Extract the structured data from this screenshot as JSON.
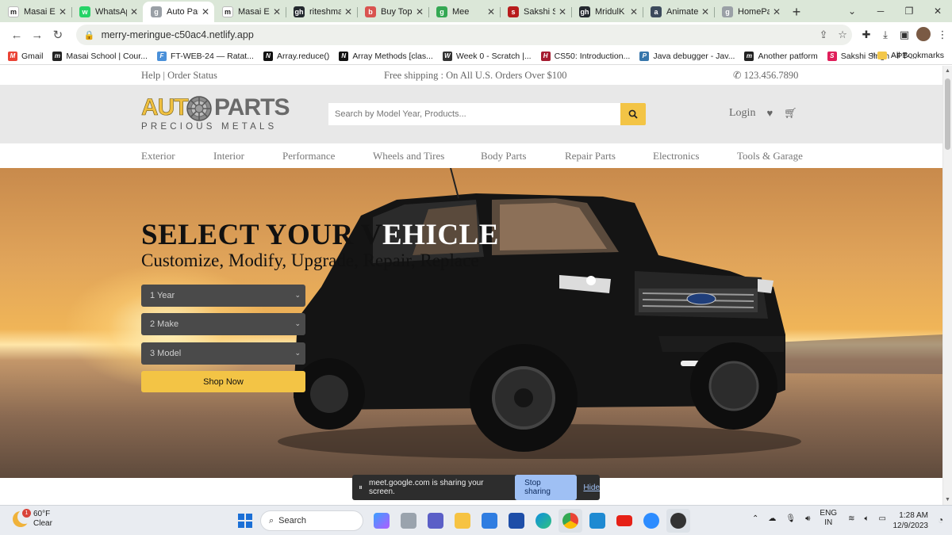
{
  "browser": {
    "tabs": [
      {
        "title": "Masai Ex",
        "fav": "m",
        "color": "#ffffff",
        "fg": "#222",
        "active": false
      },
      {
        "title": "WhatsAp",
        "fav": "w",
        "color": "#25d366",
        "fg": "#fff",
        "active": false
      },
      {
        "title": "Auto Par",
        "fav": "g",
        "color": "#9aa0a6",
        "fg": "#fff",
        "active": true
      },
      {
        "title": "Masai Ex",
        "fav": "m",
        "color": "#ffffff",
        "fg": "#222",
        "active": false
      },
      {
        "title": "riteshma",
        "fav": "gh",
        "color": "#24292f",
        "fg": "#fff",
        "active": false
      },
      {
        "title": "Buy Top",
        "fav": "b",
        "color": "#d9534f",
        "fg": "#fff",
        "active": false
      },
      {
        "title": "Mee",
        "fav": "g",
        "color": "#34a853",
        "fg": "#fff",
        "active": false
      },
      {
        "title": "Sakshi S",
        "fav": "s",
        "color": "#b71c1c",
        "fg": "#fff",
        "active": false
      },
      {
        "title": "MridulK",
        "fav": "gh",
        "color": "#24292f",
        "fg": "#fff",
        "active": false
      },
      {
        "title": "Animate",
        "fav": "a",
        "color": "#3c4a5c",
        "fg": "#fff",
        "active": false
      },
      {
        "title": "HomePa",
        "fav": "g",
        "color": "#9aa0a6",
        "fg": "#fff",
        "active": false
      }
    ],
    "url": "merry-meringue-c50ac4.netlify.app",
    "bookmarks": [
      {
        "label": "Gmail",
        "fav": "M",
        "color": "#ea4335"
      },
      {
        "label": "Masai School | Cour...",
        "fav": "m",
        "color": "#222222"
      },
      {
        "label": "FT-WEB-24 — Ratat...",
        "fav": "F",
        "color": "#4a90d9"
      },
      {
        "label": "Array.reduce()",
        "fav": "N",
        "color": "#111111"
      },
      {
        "label": "Array Methods [clas...",
        "fav": "N",
        "color": "#111111"
      },
      {
        "label": "Week 0 - Scratch |...",
        "fav": "W",
        "color": "#333333"
      },
      {
        "label": "CS50: Introduction...",
        "fav": "H",
        "color": "#a51c30"
      },
      {
        "label": "Java debugger - Jav...",
        "fav": "P",
        "color": "#3776ab"
      },
      {
        "label": "Another patform",
        "fav": "m",
        "color": "#222222"
      },
      {
        "label": "Sakshi Singh - PT-...",
        "fav": "S",
        "color": "#e01e5a"
      }
    ],
    "bookmarks_more": "»",
    "all_bookmarks": "All Bookmarks"
  },
  "site": {
    "topbar": {
      "help": "Help",
      "order_status": "Order Status",
      "shipping": "Free shipping : On All U.S. Orders Over $100",
      "phone": "123.456.7890"
    },
    "logo": {
      "auto": "AUT",
      "parts": "PARTS",
      "tagline": "PRECIOUS METALS"
    },
    "search_placeholder": "Search by Model Year, Products...",
    "login": "Login",
    "categories": [
      "Exterior",
      "Interior",
      "Performance",
      "Wheels and Tires",
      "Body Parts",
      "Repair Parts",
      "Electronics",
      "Tools & Garage"
    ],
    "hero": {
      "title_dark": "SELECT YOUR V",
      "title_light": "EHICLE",
      "subtitle": "Customize, Modify, Upgrade, Repair, Replace",
      "selects": [
        "1 Year",
        "2 Make",
        "3 Model"
      ],
      "shop_label": "Shop Now"
    }
  },
  "share_bar": {
    "message": "meet.google.com is sharing your screen.",
    "stop": "Stop sharing",
    "hide": "Hide"
  },
  "taskbar": {
    "weather_temp": "60°F",
    "weather_desc": "Clear",
    "weather_badge": "1",
    "search_label": "Search",
    "lang_top": "ENG",
    "lang_bottom": "IN",
    "time": "1:28 AM",
    "date": "12/9/2023"
  }
}
